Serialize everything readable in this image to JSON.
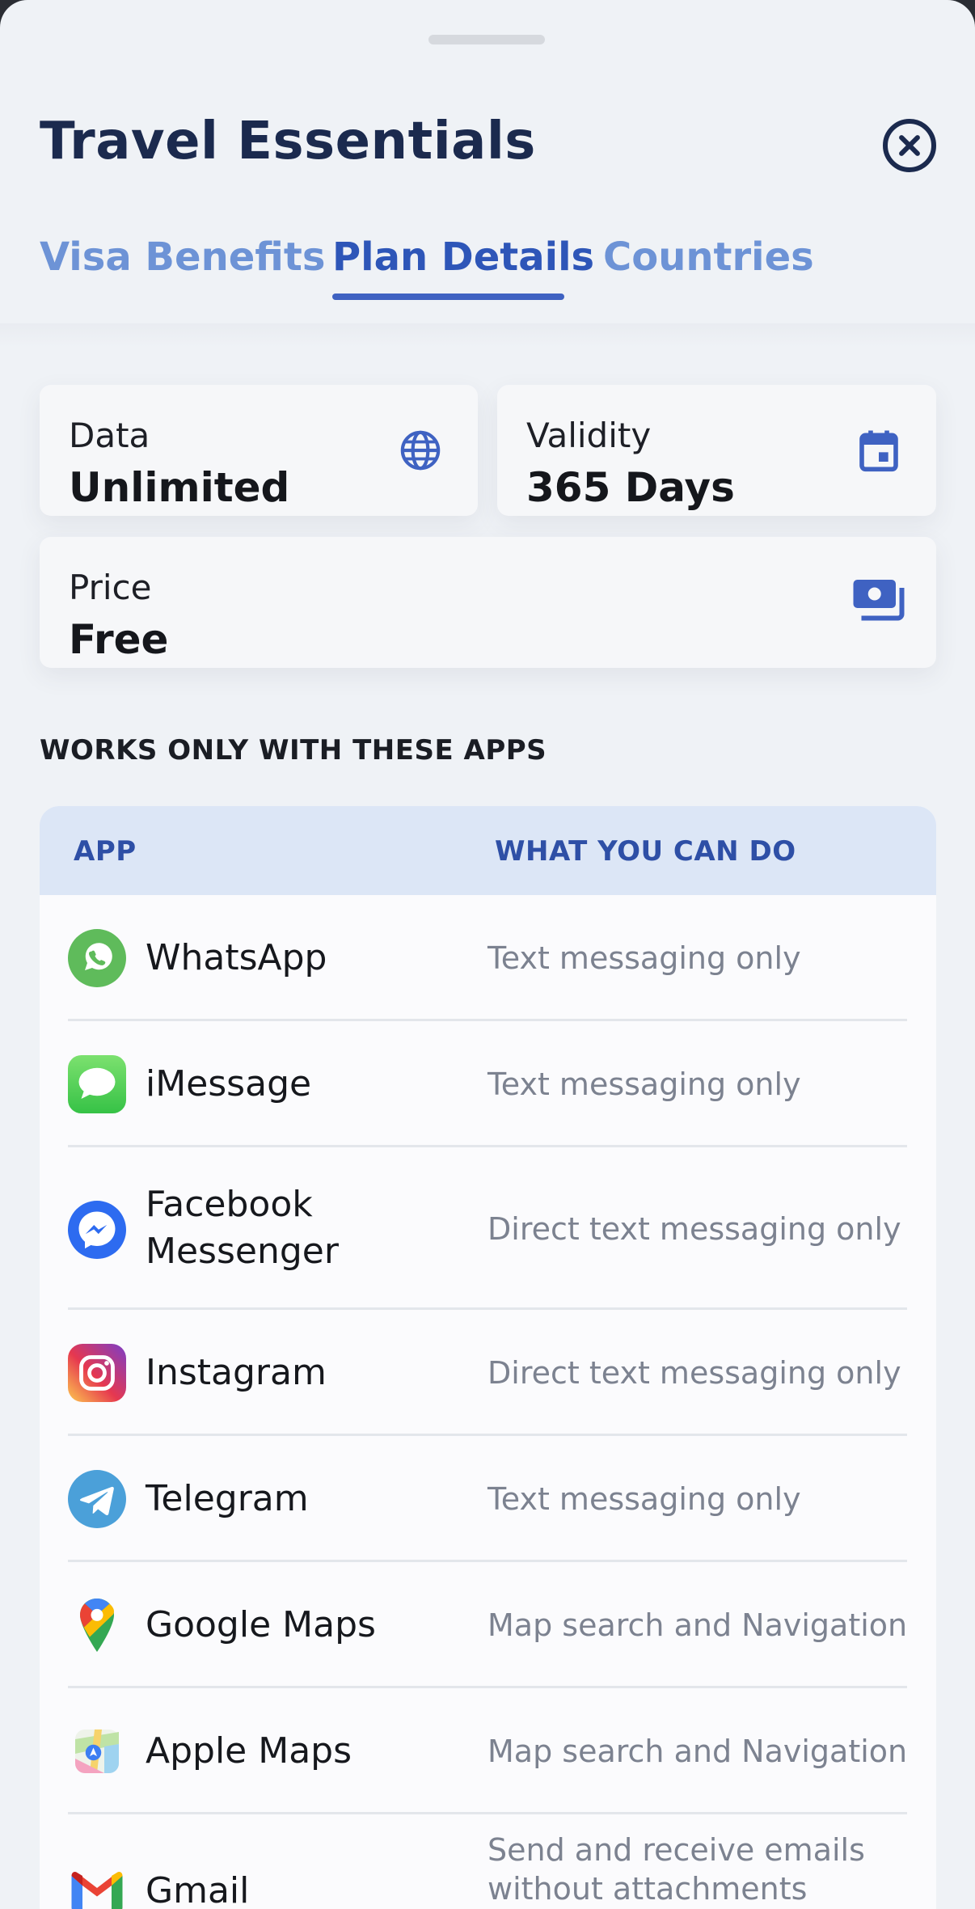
{
  "sheet": {
    "title": "Travel Essentials",
    "tabs": [
      {
        "label": "Visa Benefits",
        "active": false
      },
      {
        "label": "Plan Details",
        "active": true
      },
      {
        "label": "Countries",
        "active": false
      }
    ]
  },
  "plan": {
    "data": {
      "label": "Data",
      "value": "Unlimited",
      "icon": "globe-icon"
    },
    "validity": {
      "label": "Validity",
      "value": "365 Days",
      "icon": "calendar-icon"
    },
    "price": {
      "label": "Price",
      "value": "Free",
      "icon": "money-icon"
    }
  },
  "apps_section": {
    "heading": "WORKS ONLY WITH THESE APPS",
    "columns": [
      "APP",
      "WHAT YOU CAN DO"
    ],
    "rows": [
      {
        "name": "WhatsApp",
        "desc": "Text messaging only",
        "icon": "whatsapp-icon"
      },
      {
        "name": "iMessage",
        "desc": "Text messaging only",
        "icon": "imessage-icon"
      },
      {
        "name": "Facebook Messenger",
        "desc": "Direct text messaging only",
        "icon": "messenger-icon"
      },
      {
        "name": "Instagram",
        "desc": "Direct text messaging only",
        "icon": "instagram-icon"
      },
      {
        "name": "Telegram",
        "desc": "Text messaging only",
        "icon": "telegram-icon"
      },
      {
        "name": "Google Maps",
        "desc": "Map search and Navigation",
        "icon": "google-maps-icon"
      },
      {
        "name": "Apple Maps",
        "desc": "Map search and Navigation",
        "icon": "apple-maps-icon"
      },
      {
        "name": "Gmail",
        "desc": "Send and receive emails without attachments",
        "icon": "gmail-icon"
      }
    ]
  },
  "colors": {
    "accent": "#3f62c2",
    "tab_inactive": "#6d93d6",
    "title": "#1b2a4e",
    "header_bg": "#dce6f6"
  }
}
